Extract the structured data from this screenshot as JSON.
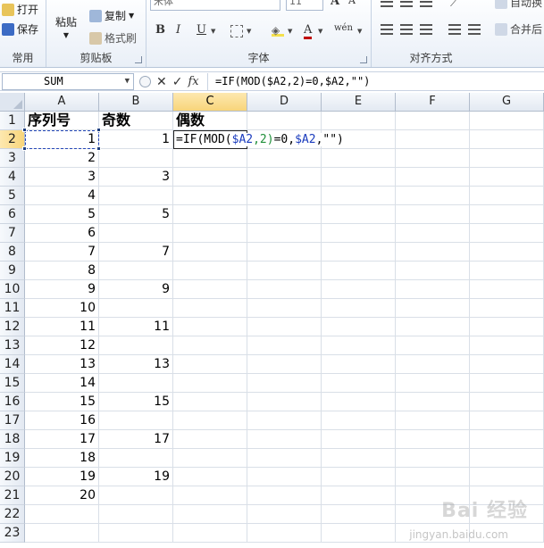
{
  "ribbon": {
    "groups": {
      "common": "常用",
      "clipboard": "剪贴板",
      "font": "字体",
      "alignment": "对齐方式"
    },
    "buttons": {
      "open": "打开",
      "save": "保存",
      "paste": "粘贴",
      "copy": "复制",
      "format_painter": "格式刷",
      "merge": "合并后",
      "auto": "自动换"
    },
    "font": {
      "name": "宋体",
      "size": "11",
      "bold": "B",
      "italic": "I",
      "underline": "U",
      "grow": "A",
      "shrink": "A",
      "font_color": "A",
      "phonetic": "wén"
    }
  },
  "formula_bar": {
    "name_box": "SUM",
    "formula": "=IF(MOD($A2,2)=0,$A2,\"\")",
    "fx": "fx"
  },
  "sheet": {
    "columns": [
      "A",
      "B",
      "C",
      "D",
      "E",
      "F",
      "G"
    ],
    "rows": [
      "1",
      "2",
      "3",
      "4",
      "5",
      "6",
      "7",
      "8",
      "9",
      "10",
      "11",
      "12",
      "13",
      "14",
      "15",
      "16",
      "17",
      "18",
      "19",
      "20",
      "21",
      "22",
      "23"
    ],
    "headers": {
      "a": "序列号",
      "b": "奇数",
      "c": "偶数"
    },
    "col_a": [
      "1",
      "2",
      "3",
      "4",
      "5",
      "6",
      "7",
      "8",
      "9",
      "10",
      "11",
      "12",
      "13",
      "14",
      "15",
      "16",
      "17",
      "18",
      "19",
      "20"
    ],
    "col_b": [
      "1",
      "",
      "3",
      "",
      "5",
      "",
      "7",
      "",
      "9",
      "",
      "11",
      "",
      "13",
      "",
      "15",
      "",
      "17",
      "",
      "19",
      ""
    ],
    "editing_cell": {
      "p1": "=IF(MOD(",
      "p2": "$A2",
      "p3": ",2)",
      "p4": "=0,",
      "p5": "$A2",
      "p6": ",\"\")"
    }
  },
  "watermark": {
    "main": "Bai 经验",
    "sub": "jingyan.baidu.com"
  }
}
